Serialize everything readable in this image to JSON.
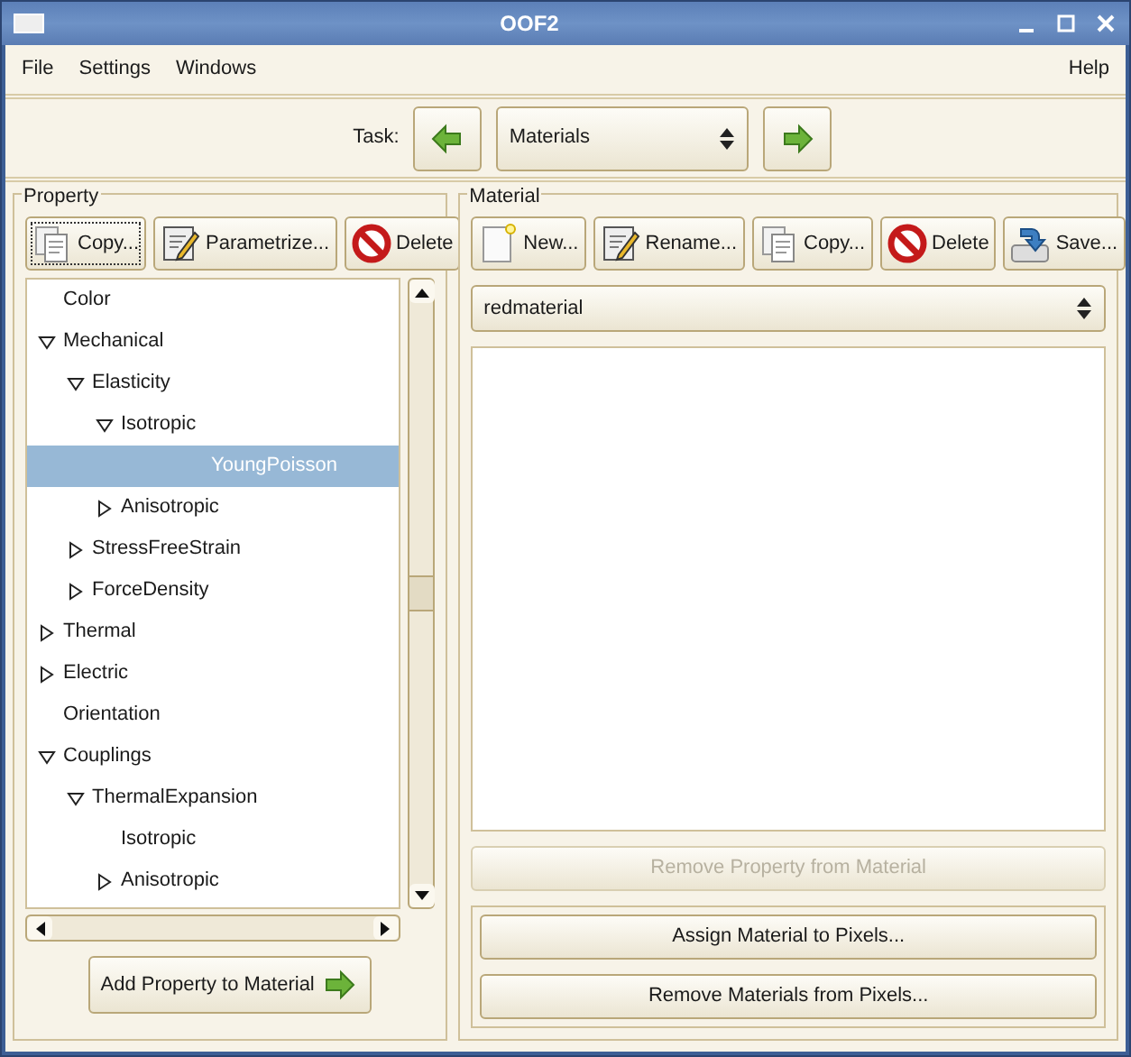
{
  "window": {
    "title": "OOF2"
  },
  "menu": [
    {
      "label": "File"
    },
    {
      "label": "Settings"
    },
    {
      "label": "Windows"
    },
    {
      "label": "Help"
    }
  ],
  "task": {
    "label": "Task:",
    "value": "Materials"
  },
  "property_panel": {
    "title": "Property",
    "buttons": [
      {
        "label": "Copy...",
        "kind": "copy",
        "focused": true
      },
      {
        "label": "Parametrize...",
        "kind": "edit",
        "focused": false
      },
      {
        "label": "Delete",
        "kind": "delete",
        "focused": false
      }
    ],
    "tree": [
      {
        "label": "Color",
        "selected": false
      },
      {
        "label": "Mechanical",
        "selected": false,
        "expanded": true,
        "children": [
          {
            "label": "Elasticity",
            "selected": false,
            "expanded": true,
            "children": [
              {
                "label": "Isotropic",
                "selected": false,
                "expanded": true,
                "children": [
                  {
                    "label": "YoungPoisson",
                    "selected": true
                  }
                ]
              },
              {
                "label": "Anisotropic",
                "selected": false,
                "expanded": false
              }
            ]
          },
          {
            "label": "StressFreeStrain",
            "selected": false,
            "expanded": false
          },
          {
            "label": "ForceDensity",
            "selected": false,
            "expanded": false
          }
        ]
      },
      {
        "label": "Thermal",
        "selected": false,
        "expanded": false
      },
      {
        "label": "Electric",
        "selected": false,
        "expanded": false
      },
      {
        "label": "Orientation",
        "selected": false
      },
      {
        "label": "Couplings",
        "selected": false,
        "expanded": true,
        "children": [
          {
            "label": "ThermalExpansion",
            "selected": false,
            "expanded": true,
            "children": [
              {
                "label": "Isotropic",
                "selected": false
              },
              {
                "label": "Anisotropic",
                "selected": false,
                "expanded": false
              }
            ]
          }
        ]
      }
    ],
    "add_button": {
      "label": "Add Property to Material"
    }
  },
  "material_panel": {
    "title": "Material",
    "buttons": [
      {
        "label": "New...",
        "kind": "new",
        "focused": false
      },
      {
        "label": "Rename...",
        "kind": "edit",
        "focused": false
      },
      {
        "label": "Copy...",
        "kind": "copy",
        "focused": false
      },
      {
        "label": "Delete",
        "kind": "delete",
        "focused": false
      },
      {
        "label": "Save...",
        "kind": "save",
        "focused": false
      }
    ],
    "selector": {
      "value": "redmaterial"
    },
    "remove_property_button": {
      "label": "Remove Property from Material",
      "disabled": true
    },
    "pixel_buttons": [
      {
        "label": "Assign Material to Pixels..."
      },
      {
        "label": "Remove Materials from Pixels..."
      }
    ]
  }
}
